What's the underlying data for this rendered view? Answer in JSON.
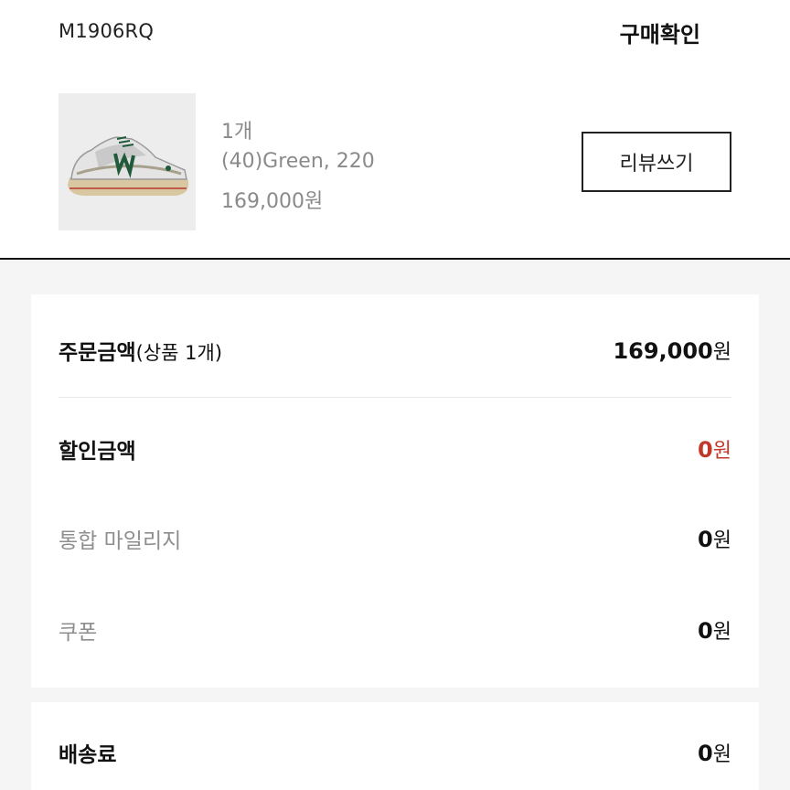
{
  "header": {
    "model_code": "M1906RQ",
    "confirm_purchase": "구매확인"
  },
  "product": {
    "image_icon": "sneaker-photo",
    "quantity": "1개",
    "variant": "(40)Green, 220",
    "price": "169,000원",
    "review_button": "리뷰쓰기"
  },
  "summary": {
    "order_amount_label": "주문금액",
    "order_amount_sub": "(상품 1개)",
    "order_amount_value": "169,000",
    "discount_label": "할인금액",
    "discount_value": "0",
    "mileage_label": "통합 마일리지",
    "mileage_value": "0",
    "coupon_label": "쿠폰",
    "coupon_value": "0",
    "currency_unit": "원"
  },
  "shipping": {
    "label": "배송료",
    "value": "0"
  },
  "colors": {
    "discount_red": "#c0392b",
    "muted_text": "#8e8e8e",
    "background": "#f5f5f5"
  }
}
